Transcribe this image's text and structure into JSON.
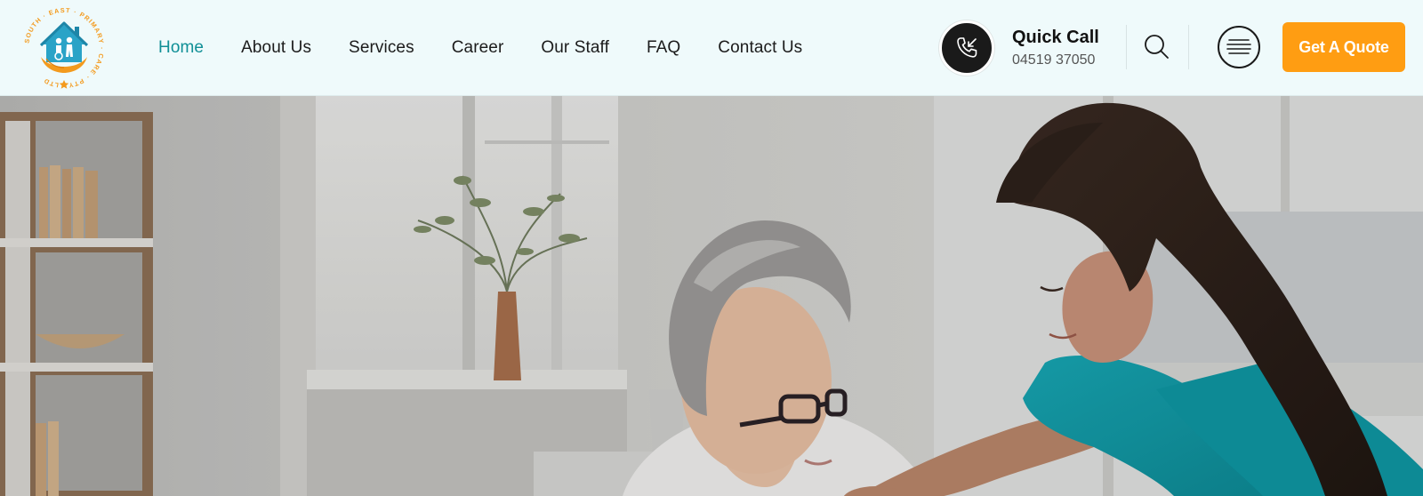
{
  "logo": {
    "ring_text": "SOUTH · EAST · PRIMARY · CARE · PTY · LTD",
    "colors": {
      "house": "#2aa3c7",
      "hands": "#f39a1d",
      "ring": "#f39a1d"
    }
  },
  "nav": {
    "items": [
      {
        "label": "Home",
        "active": true
      },
      {
        "label": "About Us",
        "active": false
      },
      {
        "label": "Services",
        "active": false
      },
      {
        "label": "Career",
        "active": false
      },
      {
        "label": "Our Staff",
        "active": false
      },
      {
        "label": "FAQ",
        "active": false
      },
      {
        "label": "Contact Us",
        "active": false
      }
    ],
    "active_color": "#0f8f96"
  },
  "quick_call": {
    "title": "Quick Call",
    "number": "04519 37050",
    "icon": "phone-incoming-icon"
  },
  "header_actions": {
    "search_icon": "search-icon",
    "menu_icon": "hamburger-menu-icon",
    "quote_label": "Get A Quote",
    "quote_color": "#ff9d12"
  },
  "hero": {
    "image_description_icon": "hero-photo"
  }
}
